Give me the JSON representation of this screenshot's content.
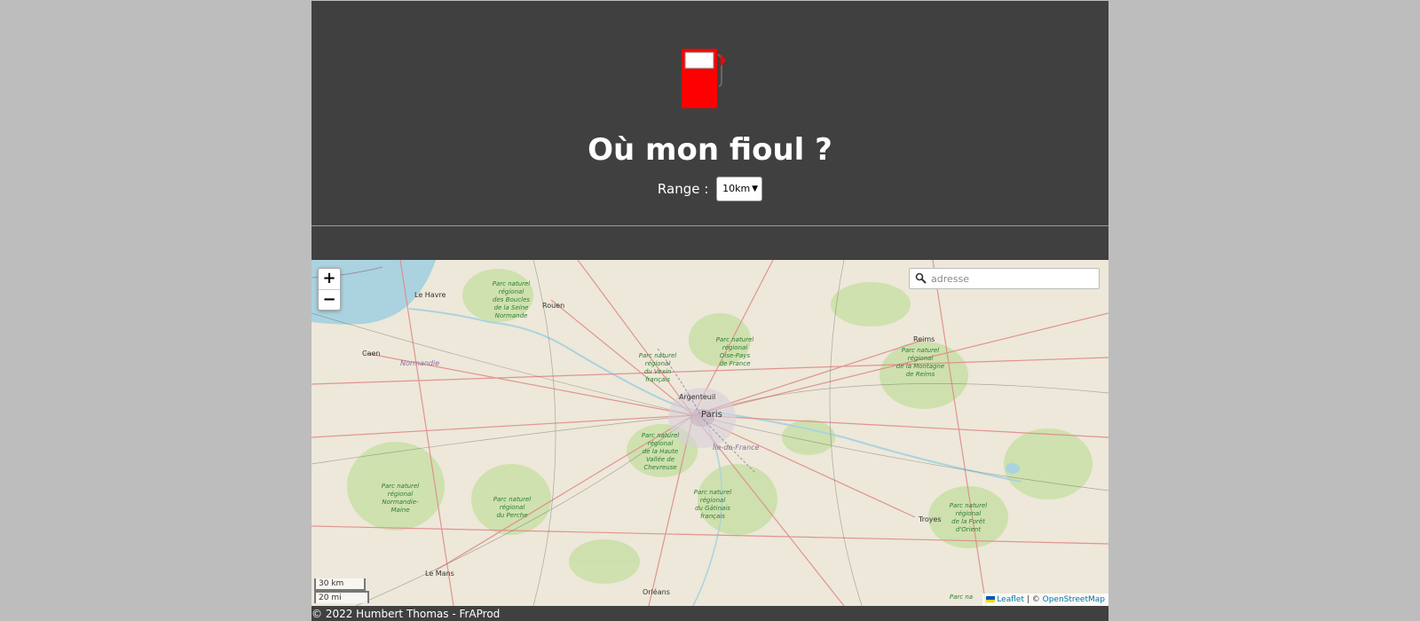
{
  "header": {
    "title": "Où mon fioul ?",
    "range_label": "Range :",
    "range_selected": "10km",
    "icon": "fuel-pump-icon"
  },
  "map": {
    "search": {
      "placeholder": "adresse",
      "icon": "search-icon"
    },
    "zoom": {
      "in_label": "+",
      "out_label": "−"
    },
    "scale": {
      "km": "30 km",
      "mi": "20 mi"
    },
    "attribution": {
      "leaflet": "Leaflet",
      "separator": " | © ",
      "osm": "OpenStreetMap"
    },
    "places": {
      "le_havre": "Le Havre",
      "rouen": "Rouen",
      "caen": "Caen",
      "normandie": "Normandie",
      "reims": "Reims",
      "argenteuil": "Argenteuil",
      "paris": "Paris",
      "ile_de_france": "Île-de-France",
      "troyes": "Troyes",
      "le_mans": "Le Mans",
      "orleans": "Orléans"
    },
    "parks": {
      "boucles_seine": [
        "Parc naturel",
        "régional",
        "des Boucles",
        "de la Seine",
        "Normande"
      ],
      "vexin": [
        "Parc naturel",
        "régional",
        "du Vexin",
        "français"
      ],
      "oise": [
        "Parc naturel",
        "régional",
        "Oise-Pays",
        "de France"
      ],
      "montagne_reims": [
        "Parc naturel",
        "régional",
        "de la Montagne",
        "de Reims"
      ],
      "chevreuse": [
        "Parc naturel",
        "régional",
        "de la Haute",
        "Vallée de",
        "Chevreuse"
      ],
      "normandie_maine": [
        "Parc naturel",
        "régional",
        "Normandie-",
        "Maine"
      ],
      "perche": [
        "Parc naturel",
        "régional",
        "du Perche"
      ],
      "gatinais": [
        "Parc naturel",
        "régional",
        "du Gâtinais",
        "français"
      ],
      "foret_orient": [
        "Parc naturel",
        "régional",
        "de la Forêt",
        "d'Orient"
      ],
      "loire": "Parc na"
    },
    "colors": {
      "land": "#ede8d9",
      "water": "#aad3df",
      "forest": "#c9dfa6",
      "road": "#e08a8a",
      "boundary": "#9b8fb0"
    }
  },
  "footer": {
    "copyright": "© 2022 Humbert Thomas - FrAProd"
  },
  "colors": {
    "page_bg": "#404040",
    "outer_bg": "#bdbdbd",
    "pump_red": "#ff0000",
    "accent_link": "#0078a8"
  }
}
